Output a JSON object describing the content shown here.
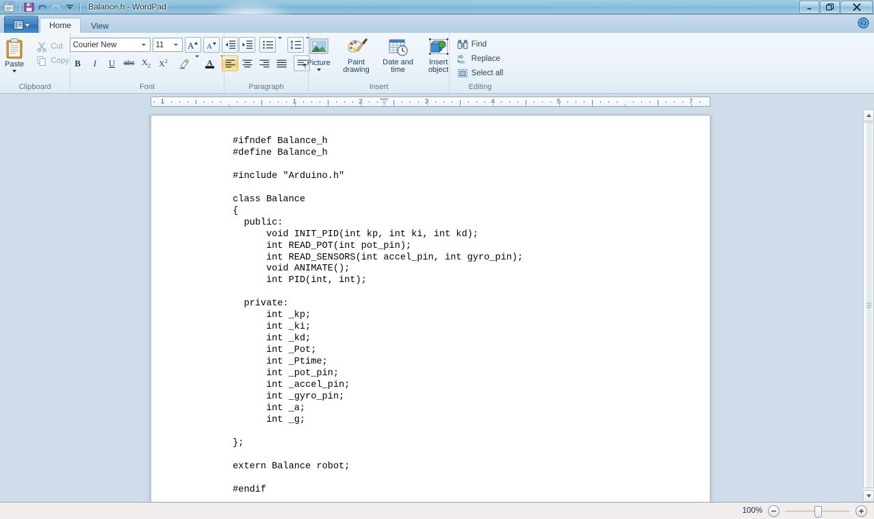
{
  "window": {
    "title": "Balance.h - WordPad",
    "app_icon": "wordpad-icon",
    "quick_access": [
      {
        "name": "save-icon",
        "label": "Save"
      },
      {
        "name": "undo-icon",
        "label": "Undo"
      },
      {
        "name": "redo-icon",
        "label": "Redo"
      },
      {
        "name": "customize-quick-access-icon",
        "label": "Customize Quick Access Toolbar"
      }
    ],
    "controls": [
      {
        "name": "minimize-button",
        "glyph": "—"
      },
      {
        "name": "restore-button",
        "glyph": "❐"
      },
      {
        "name": "close-button",
        "glyph": "✕"
      }
    ]
  },
  "ribbon": {
    "app_menu_label": "",
    "help_label": "?",
    "tabs": [
      {
        "label": "Home",
        "active": true
      },
      {
        "label": "View",
        "active": false
      }
    ],
    "groups": {
      "clipboard": {
        "label": "Clipboard",
        "paste": "Paste",
        "cut": "Cut",
        "copy": "Copy"
      },
      "font": {
        "label": "Font",
        "font_family": "Courier New",
        "font_size": "11",
        "grow_font": "Grow font",
        "shrink_font": "Shrink font",
        "bold": "B",
        "italic": "I",
        "underline": "U",
        "strikethrough": "abc",
        "subscript": "X₂",
        "superscript": "X²",
        "text_highlight": "Text highlight color",
        "font_color": "A"
      },
      "paragraph": {
        "label": "Paragraph",
        "decrease_indent": "Decrease indent",
        "increase_indent": "Increase indent",
        "start_list": "Start a list",
        "line_spacing": "Line spacing",
        "align_left": "Align text left",
        "align_center": "Center",
        "align_right": "Align text right",
        "justify": "Justify",
        "paragraph_settings": "Paragraph"
      },
      "insert": {
        "label": "Insert",
        "picture": "Picture",
        "paint_drawing": "Paint\ndrawing",
        "date_and_time": "Date and\ntime",
        "insert_object": "Insert\nobject"
      },
      "editing": {
        "label": "Editing",
        "find": "Find",
        "replace": "Replace",
        "select_all": "Select all"
      }
    }
  },
  "ruler": {
    "numbers": [
      "1",
      "1",
      "2",
      "3",
      "4",
      "5",
      "7"
    ],
    "left_indent_marker": "left-indent-marker",
    "right_indent_marker": "right-indent-marker"
  },
  "document": {
    "filename": "Balance.h",
    "text": "#ifndef Balance_h\n#define Balance_h\n\n#include \"Arduino.h\"\n\nclass Balance\n{\n  public:\n      void INIT_PID(int kp, int ki, int kd);\n      int READ_POT(int pot_pin);\n      int READ_SENSORS(int accel_pin, int gyro_pin);\n      void ANIMATE();\n      int PID(int, int);\n\n  private:\n      int _kp;\n      int _ki;\n      int _kd;\n      int _Pot;\n      int _Ptime;\n      int _pot_pin;\n      int _accel_pin;\n      int _gyro_pin;\n      int _a;\n      int _g;\n\n};\n\nextern Balance robot;\n\n#endif"
  },
  "status": {
    "zoom_label": "100%",
    "zoom_out": "−",
    "zoom_in": "+"
  },
  "colors": {
    "ribbon_bg": "#f2f7fb",
    "tab_active_bg": "#f0f5fa",
    "desktop": "#8cc3de",
    "doc_bg": "#cfdcea",
    "page": "#ffffff",
    "accent": "#3f82c2"
  }
}
